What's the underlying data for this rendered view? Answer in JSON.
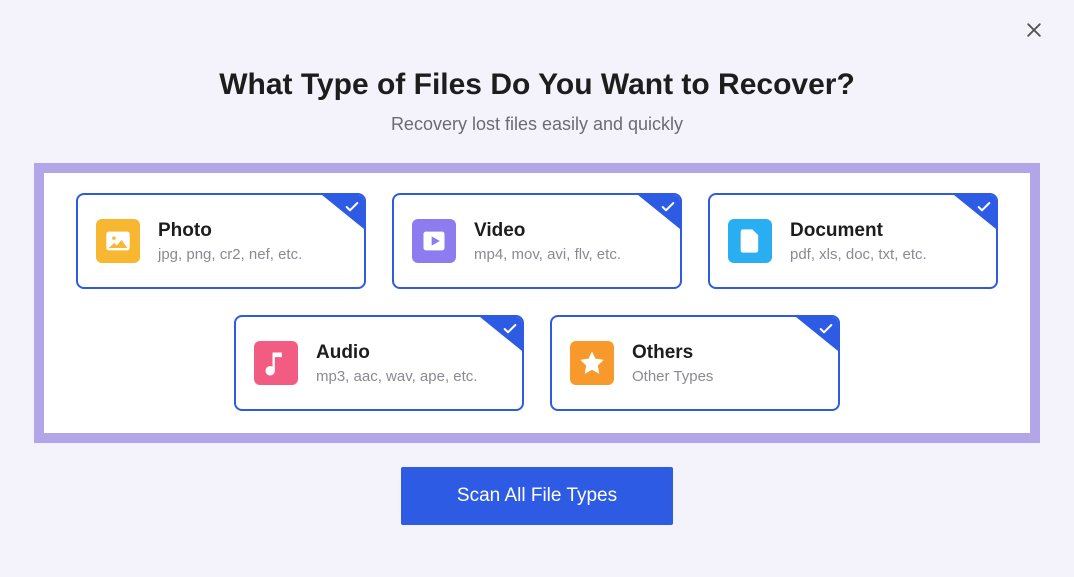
{
  "header": {
    "title": "What Type of Files Do You Want to Recover?",
    "subtitle": "Recovery lost files easily and quickly"
  },
  "cards": {
    "photo": {
      "title": "Photo",
      "desc": "jpg, png, cr2, nef, etc."
    },
    "video": {
      "title": "Video",
      "desc": "mp4, mov, avi, flv, etc."
    },
    "document": {
      "title": "Document",
      "desc": "pdf, xls, doc, txt, etc."
    },
    "audio": {
      "title": "Audio",
      "desc": "mp3, aac, wav, ape, etc."
    },
    "others": {
      "title": "Others",
      "desc": "Other Types"
    }
  },
  "actions": {
    "scan_label": "Scan All File Types"
  }
}
